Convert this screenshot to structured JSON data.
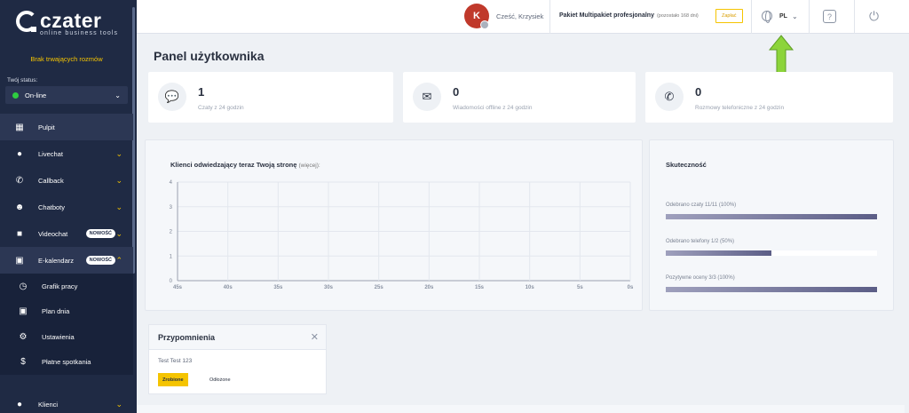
{
  "sidebar": {
    "logo_name": "czater",
    "logo_sub": "online business tools",
    "no_chats": "Brak trwających rozmów",
    "status_label": "Twój status:",
    "status_value": "On-line",
    "items": [
      {
        "label": "Pulpit",
        "icon": "dashboard-icon",
        "glyph": "▦"
      },
      {
        "label": "Livechat",
        "icon": "chat-icon",
        "glyph": "●"
      },
      {
        "label": "Callback",
        "icon": "phone-icon",
        "glyph": "✆"
      },
      {
        "label": "Chatboty",
        "icon": "robot-icon",
        "glyph": "☻"
      },
      {
        "label": "Videochat",
        "icon": "video-icon",
        "glyph": "■",
        "badge": "NOWOŚĆ"
      },
      {
        "label": "E-kalendarz",
        "icon": "calendar-icon",
        "glyph": "▣",
        "badge": "NOWOŚĆ"
      }
    ],
    "subitems": [
      {
        "label": "Grafik pracy",
        "icon": "clock-icon",
        "glyph": "◷"
      },
      {
        "label": "Plan dnia",
        "icon": "calendar-day-icon",
        "glyph": "▣"
      },
      {
        "label": "Ustawienia",
        "icon": "gear-icon",
        "glyph": "⚙"
      },
      {
        "label": "Płatne spotkania",
        "icon": "dollar-icon",
        "glyph": "$"
      }
    ],
    "bottom_item": {
      "label": "Klienci",
      "icon": "user-icon",
      "glyph": "●"
    }
  },
  "topbar": {
    "avatar_letter": "K",
    "greeting": "Cześć, Krzysiek",
    "package": "Pakiet Multipakiet profesjonalny",
    "package_remaining": "(pozostało 168 dni)",
    "pay_label": "Zapłać",
    "language": "PL"
  },
  "page": {
    "title": "Panel użytkownika"
  },
  "stats": [
    {
      "value": "1",
      "label": "Czaty z 24 godzin",
      "icon": "chat-bubble-icon"
    },
    {
      "value": "0",
      "label": "Wiadomości offline z 24 godzin",
      "icon": "envelope-icon"
    },
    {
      "value": "0",
      "label": "Rozmowy telefoniczne z 24 godzin",
      "icon": "phone-icon"
    }
  ],
  "chart_data": {
    "type": "line",
    "title": "Klienci odwiedzający teraz Twoją stronę",
    "title_more": "(więcej):",
    "x": [
      "45s",
      "40s",
      "35s",
      "30s",
      "25s",
      "20s",
      "15s",
      "10s",
      "5s",
      "0s"
    ],
    "y_ticks": [
      0,
      1,
      2,
      3,
      4
    ],
    "ylim": [
      0,
      4
    ],
    "grid": true,
    "series": [
      {
        "values": []
      }
    ]
  },
  "effectiveness": {
    "title": "Skuteczność",
    "rows": [
      {
        "label": "Odebrano czaty 11/11 (100%)",
        "fraction": 1.0
      },
      {
        "label": "Odebrano telefony 1/2 (50%)",
        "fraction": 0.5
      },
      {
        "label": "Pozytywne oceny 3/3 (100%)",
        "fraction": 1.0
      }
    ]
  },
  "reminder": {
    "title": "Przypomnienia",
    "text": "Test Test 123",
    "done_label": "Zrobione",
    "later_label": "Odłożone"
  },
  "colors": {
    "sidebar": "#1f2a44",
    "accent": "#f5c400",
    "arrow": "#8cd43a"
  }
}
